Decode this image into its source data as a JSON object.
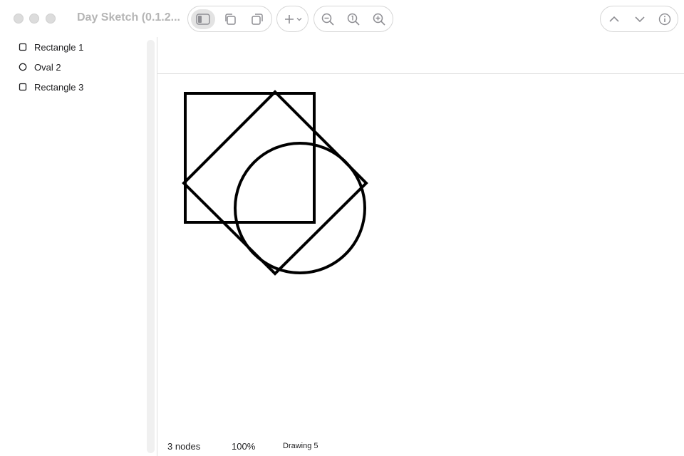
{
  "window": {
    "title": "Day Sketch (0.1.2...",
    "accent": "#e3e3e3"
  },
  "toolbar": {
    "groups": [
      [
        "sidebar-toggle-icon",
        "duplicate-icon",
        "copy-icon"
      ],
      [
        "add-icon",
        "chevron-down-icon"
      ],
      [
        "zoom-out-icon",
        "zoom-reset-icon",
        "zoom-in-icon"
      ],
      [
        "arrow-up-icon",
        "arrow-down-icon",
        "info-icon"
      ]
    ]
  },
  "sidebar": {
    "items": [
      {
        "label": "Rectangle 1",
        "icon": "rectangle-icon"
      },
      {
        "label": "Oval 2",
        "icon": "oval-icon"
      },
      {
        "label": "Rectangle 3",
        "icon": "rectangle-icon"
      }
    ]
  },
  "canvas": {
    "shapes": [
      "Rectangle 1",
      "Oval 2",
      "Rectangle 3"
    ],
    "stroke": "#000000"
  },
  "status": {
    "nodes": "3 nodes",
    "zoom": "100%",
    "document": "Drawing 5"
  }
}
